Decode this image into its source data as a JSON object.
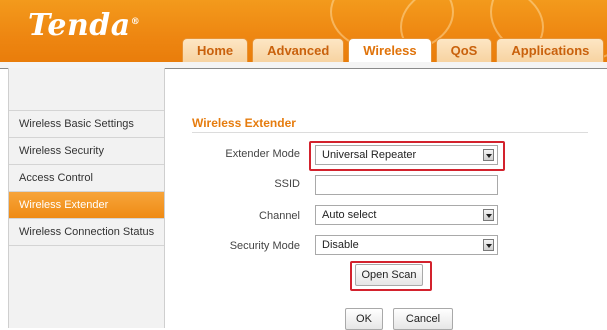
{
  "brand": {
    "logo_text": "Tenda",
    "trademark": "®"
  },
  "tabs": [
    {
      "label": "Home",
      "active": false
    },
    {
      "label": "Advanced",
      "active": false
    },
    {
      "label": "Wireless",
      "active": true
    },
    {
      "label": "QoS",
      "active": false
    },
    {
      "label": "Applications",
      "active": false
    }
  ],
  "sidebar": {
    "items": [
      {
        "label": "Wireless Basic Settings",
        "active": false
      },
      {
        "label": "Wireless Security",
        "active": false
      },
      {
        "label": "Access Control",
        "active": false
      },
      {
        "label": "Wireless Extender",
        "active": true
      },
      {
        "label": "Wireless Connection Status",
        "active": false
      }
    ]
  },
  "main": {
    "title": "Wireless Extender",
    "fields": {
      "extender_mode": {
        "label": "Extender Mode",
        "value": "Universal Repeater"
      },
      "ssid": {
        "label": "SSID",
        "value": ""
      },
      "channel": {
        "label": "Channel",
        "value": "Auto select"
      },
      "security_mode": {
        "label": "Security Mode",
        "value": "Disable"
      }
    },
    "open_scan_label": "Open Scan",
    "ok_label": "OK",
    "cancel_label": "Cancel"
  },
  "colors": {
    "brand_orange": "#ef8b14",
    "highlight_red": "#d3222d",
    "title_orange": "#e67c0e"
  }
}
